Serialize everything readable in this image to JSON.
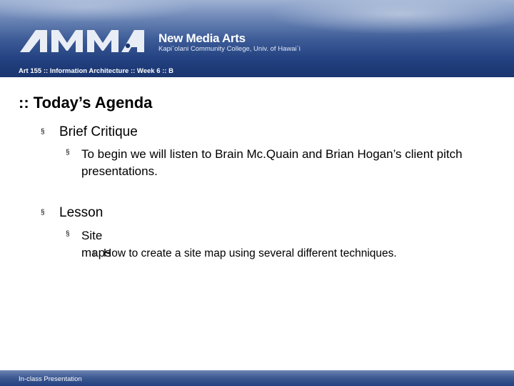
{
  "header": {
    "brand_title": "New Media Arts",
    "brand_subtitle": "Kapi`olani Community College, Univ. of Hawai`i",
    "course_line": "Art 155 :: Information Architecture :: Week 6 :: B"
  },
  "slide": {
    "title": ":: Today’s Agenda",
    "bullet_glyph": "§",
    "items": [
      {
        "text": "Brief Critique",
        "children": [
          {
            "text": "To begin we will listen to Brain Mc.Quain and Brian Hogan’s client pitch presentations."
          }
        ]
      },
      {
        "text": "Lesson",
        "children": [
          {
            "text": "Site maps",
            "children": [
              {
                "text": "How to create a site map using several different techniques."
              }
            ]
          }
        ]
      }
    ]
  },
  "footer": {
    "text": "In-class Presentation"
  },
  "colors": {
    "header_dark": "#1a356f",
    "header_light": "#9fb2d3",
    "text": "#000000"
  }
}
